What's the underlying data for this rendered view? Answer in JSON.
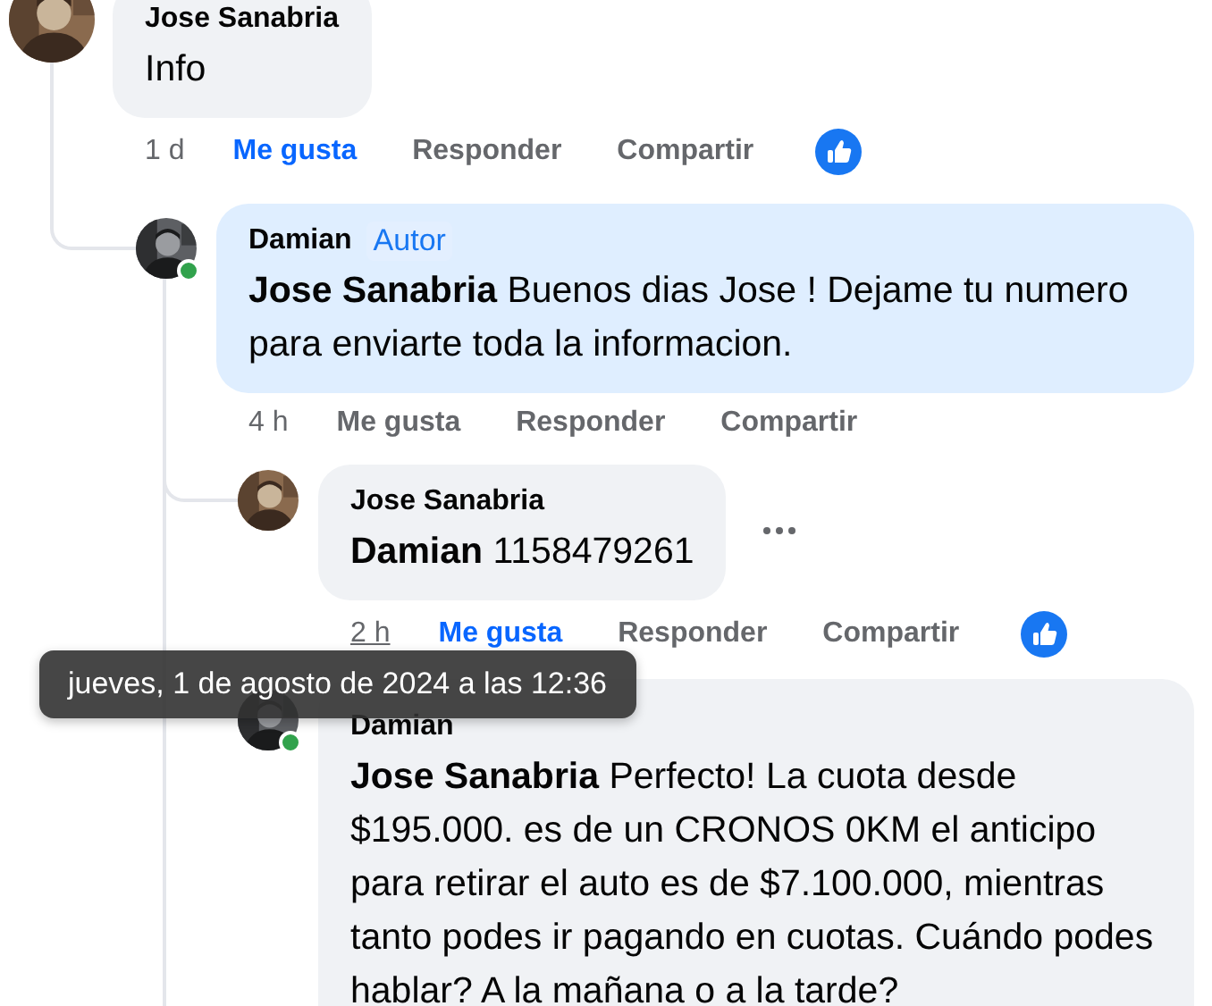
{
  "comments": [
    {
      "author": "Jose Sanabria",
      "body": "Info",
      "highlighted": false,
      "online": false,
      "more_menu": false,
      "avatar": {
        "kind": "picture"
      },
      "actions": {
        "time": "1 d",
        "time_hovered": false,
        "like": "Me gusta",
        "liked": true,
        "reply": "Responder",
        "share": "Compartir",
        "reaction": true
      },
      "children": [
        {
          "author": "Damian",
          "badge": "Autor",
          "body": "**Jose Sanabria** Buenos dias Jose ! Dejame tu numero para enviarte toda la informacion.",
          "highlighted": true,
          "online": true,
          "more_menu": false,
          "avatar": {
            "kind": "picture"
          },
          "actions": {
            "time": "4 h",
            "time_hovered": false,
            "like": "Me gusta",
            "liked": false,
            "reply": "Responder",
            "share": "Compartir",
            "reaction": false
          },
          "children": [
            {
              "author": "Jose Sanabria",
              "body": "**Damian** 1158479261",
              "highlighted": false,
              "online": false,
              "more_menu": true,
              "avatar": {
                "kind": "picture"
              },
              "actions": {
                "time": "2 h",
                "time_hovered": true,
                "like": "Me gusta",
                "liked": true,
                "reply": "Responder",
                "share": "Compartir",
                "reaction": true
              }
            },
            {
              "author": "Damian",
              "body": "**Jose Sanabria** Perfecto! La cuota desde $195.000. es de un CRONOS 0KM el anticipo para retirar el auto es de $7.100.000, mientras tanto podes ir pagando en cuotas. Cuándo podes hablar? A la mañana o a la tarde?",
              "highlighted": false,
              "online": true,
              "more_menu": false,
              "avatar": {
                "kind": "picture"
              }
            }
          ]
        }
      ]
    }
  ],
  "tooltip": {
    "text": "jueves, 1 de agosto de 2024 a las 12:36"
  }
}
